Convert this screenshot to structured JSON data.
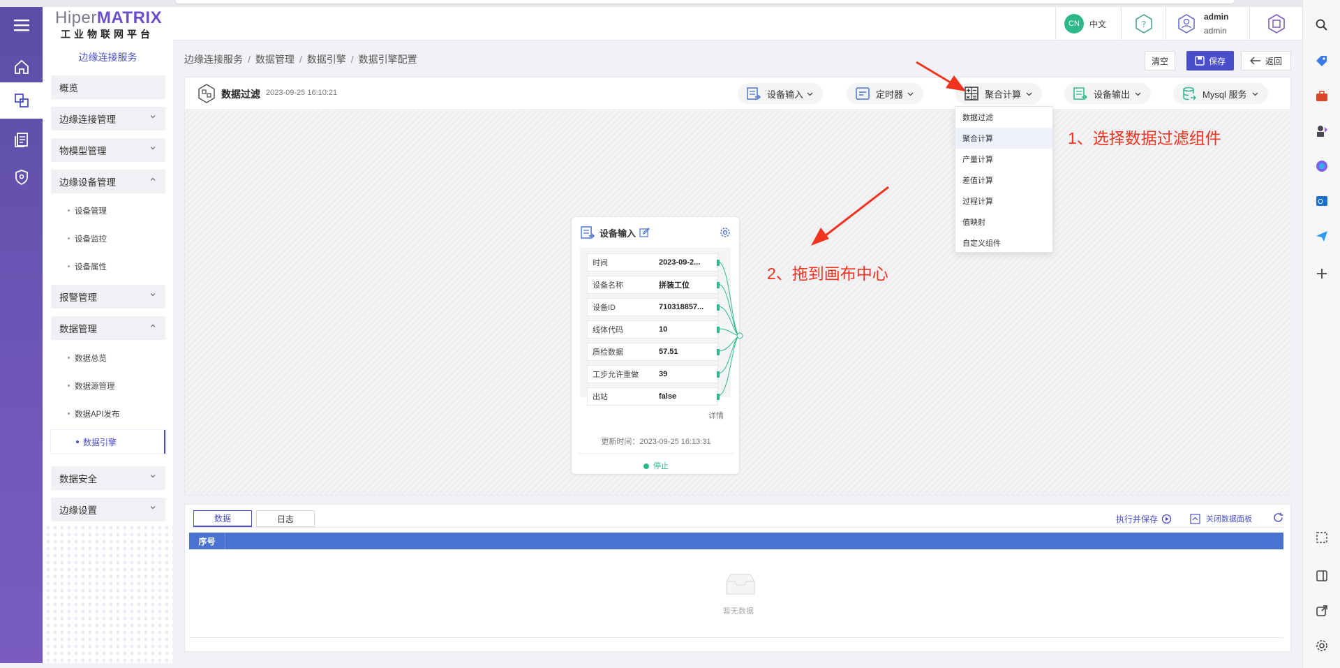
{
  "app": {
    "logo_main_a": "Hiper",
    "logo_main_b": "MATRIX",
    "logo_sub": "工业物联网平台",
    "service_title": "边缘连接服务"
  },
  "header": {
    "lang_badge": "CN",
    "lang_label": "中文",
    "user_name": "admin",
    "user_role": "admin"
  },
  "sidebar": {
    "groups": [
      {
        "label": "概览"
      },
      {
        "label": "边缘连接管理"
      },
      {
        "label": "物模型管理"
      },
      {
        "label": "边缘设备管理"
      },
      {
        "label": "报警管理"
      },
      {
        "label": "数据管理"
      },
      {
        "label": "数据安全"
      },
      {
        "label": "边缘设置"
      }
    ],
    "device_subs": [
      "设备管理",
      "设备监控",
      "设备属性"
    ],
    "data_subs": [
      "数据总览",
      "数据源管理",
      "数据API发布",
      "数据引擎"
    ]
  },
  "breadcrumb": [
    "边缘连接服务",
    "数据管理",
    "数据引擎",
    "数据引擎配置"
  ],
  "breadcrumb_sep": "/",
  "actions": {
    "clear": "清空",
    "save": "保存",
    "back": "返回"
  },
  "flow": {
    "title": "数据过滤",
    "date": "2023-09-25 16:10:21"
  },
  "toolbar": [
    {
      "label": "设备输入",
      "icon": "device-input-icon"
    },
    {
      "label": "定时器",
      "icon": "timer-icon"
    },
    {
      "label": "聚合计算",
      "icon": "aggregate-calc-icon"
    },
    {
      "label": "设备输出",
      "icon": "device-output-icon"
    },
    {
      "label": "Mysql 服务",
      "icon": "database-icon"
    }
  ],
  "dropdown": {
    "options": [
      "数据过滤",
      "聚合计算",
      "产量计算",
      "差值计算",
      "过程计算",
      "值映射",
      "自定义组件"
    ],
    "highlighted": "聚合计算"
  },
  "node": {
    "title": "设备输入",
    "rows": [
      {
        "key": "时间",
        "value": "2023-09-2..."
      },
      {
        "key": "设备名称",
        "value": "拼装工位"
      },
      {
        "key": "设备ID",
        "value": "710318857..."
      },
      {
        "key": "线体代码",
        "value": "10"
      },
      {
        "key": "质检数据",
        "value": "57.51"
      },
      {
        "key": "工步允许重做",
        "value": "39"
      },
      {
        "key": "出站",
        "value": "false"
      }
    ],
    "detail": "详情",
    "update_time": "更新时间：2023-09-25 16:13:31",
    "status": "停止"
  },
  "annotations": {
    "step1": "1、选择数据过滤组件",
    "step2": "2、拖到画布中心",
    "color": "#f0331e"
  },
  "panel": {
    "tabs": [
      "数据",
      "日志"
    ],
    "active_tab": "数据",
    "run_save": "执行并保存",
    "close_panel": "关闭数据面板",
    "columns": [
      "序号"
    ],
    "empty_text": "暂无数据"
  },
  "colors": {
    "primary": "#4a4fc9",
    "rail": "#5b4ea6",
    "status_green": "#2fb887",
    "table_header": "#4a73d1"
  }
}
